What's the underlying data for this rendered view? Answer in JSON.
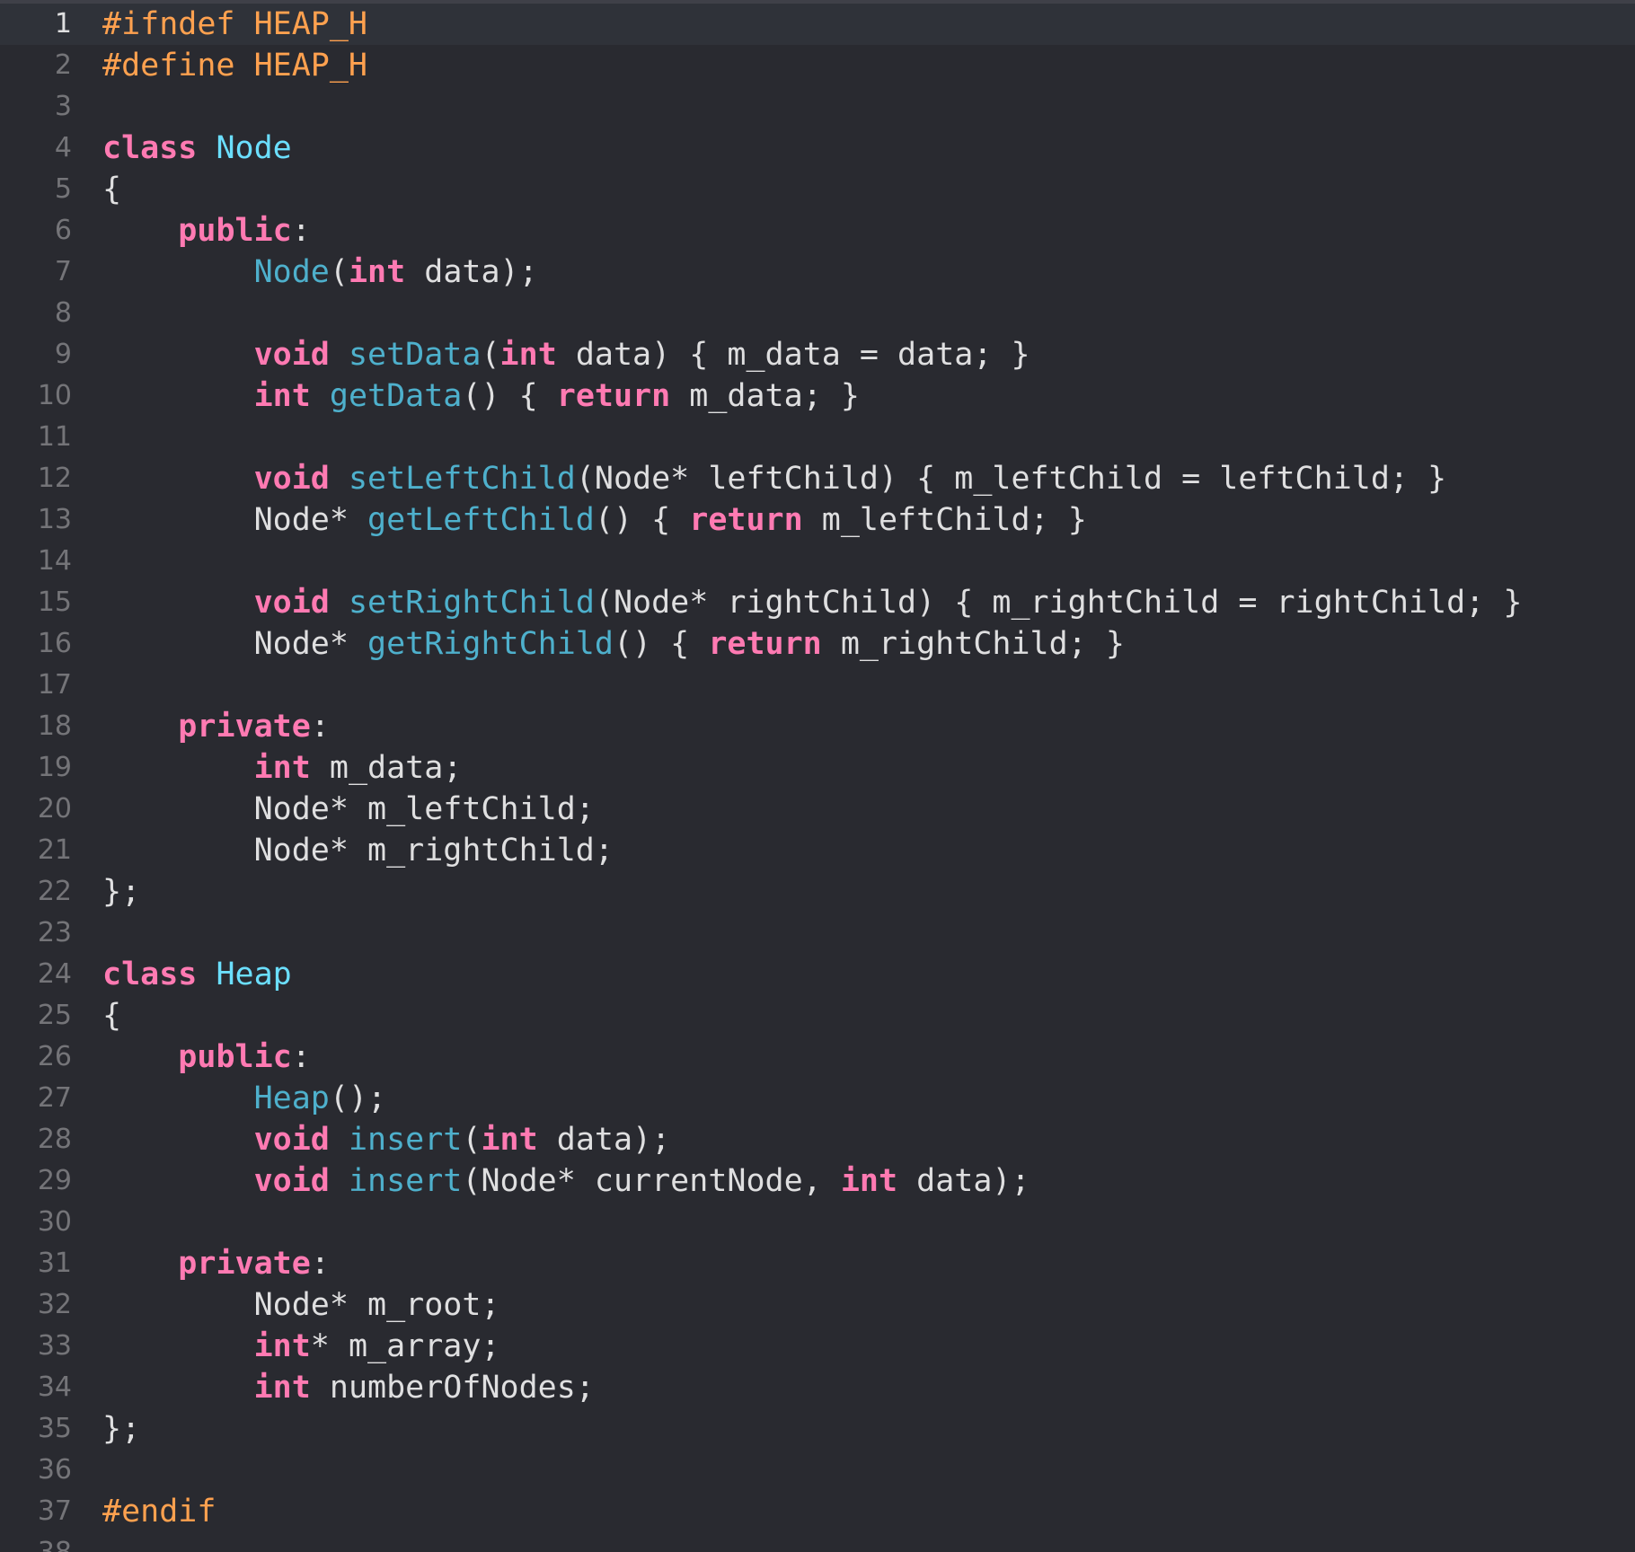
{
  "editor": {
    "language": "C++",
    "current_line": 1,
    "colors": {
      "background": "#292a30",
      "current_line_background": "#2f3239",
      "line_number": "#747478",
      "current_line_number": "#dfdfe0",
      "plain_text": "#dfdfe0",
      "keyword": "#ff7ab2",
      "preprocessor": "#ffa14f",
      "type_declaration": "#6bdfff",
      "function_name": "#4eb0cc"
    },
    "lines": [
      {
        "n": "1",
        "tokens": [
          {
            "t": "pp",
            "v": "#ifndef HEAP_H"
          }
        ]
      },
      {
        "n": "2",
        "tokens": [
          {
            "t": "pp",
            "v": "#define HEAP_H"
          }
        ]
      },
      {
        "n": "3",
        "tokens": []
      },
      {
        "n": "4",
        "tokens": [
          {
            "t": "kw",
            "v": "class"
          },
          {
            "t": "plain",
            "v": " "
          },
          {
            "t": "type",
            "v": "Node"
          }
        ]
      },
      {
        "n": "5",
        "tokens": [
          {
            "t": "plain",
            "v": "{"
          }
        ]
      },
      {
        "n": "6",
        "tokens": [
          {
            "t": "plain",
            "v": "    "
          },
          {
            "t": "kw",
            "v": "public"
          },
          {
            "t": "plain",
            "v": ":"
          }
        ]
      },
      {
        "n": "7",
        "tokens": [
          {
            "t": "plain",
            "v": "        "
          },
          {
            "t": "fn",
            "v": "Node"
          },
          {
            "t": "plain",
            "v": "("
          },
          {
            "t": "kw",
            "v": "int"
          },
          {
            "t": "plain",
            "v": " data);"
          }
        ]
      },
      {
        "n": "8",
        "tokens": []
      },
      {
        "n": "9",
        "tokens": [
          {
            "t": "plain",
            "v": "        "
          },
          {
            "t": "kw",
            "v": "void"
          },
          {
            "t": "plain",
            "v": " "
          },
          {
            "t": "fn",
            "v": "setData"
          },
          {
            "t": "plain",
            "v": "("
          },
          {
            "t": "kw",
            "v": "int"
          },
          {
            "t": "plain",
            "v": " data) { m_data = data; }"
          }
        ]
      },
      {
        "n": "10",
        "tokens": [
          {
            "t": "plain",
            "v": "        "
          },
          {
            "t": "kw",
            "v": "int"
          },
          {
            "t": "plain",
            "v": " "
          },
          {
            "t": "fn",
            "v": "getData"
          },
          {
            "t": "plain",
            "v": "() { "
          },
          {
            "t": "kw",
            "v": "return"
          },
          {
            "t": "plain",
            "v": " m_data; }"
          }
        ]
      },
      {
        "n": "11",
        "tokens": []
      },
      {
        "n": "12",
        "tokens": [
          {
            "t": "plain",
            "v": "        "
          },
          {
            "t": "kw",
            "v": "void"
          },
          {
            "t": "plain",
            "v": " "
          },
          {
            "t": "fn",
            "v": "setLeftChild"
          },
          {
            "t": "plain",
            "v": "(Node* leftChild) { m_leftChild = leftChild; }"
          }
        ]
      },
      {
        "n": "13",
        "tokens": [
          {
            "t": "plain",
            "v": "        Node* "
          },
          {
            "t": "fn",
            "v": "getLeftChild"
          },
          {
            "t": "plain",
            "v": "() { "
          },
          {
            "t": "kw",
            "v": "return"
          },
          {
            "t": "plain",
            "v": " m_leftChild; }"
          }
        ]
      },
      {
        "n": "14",
        "tokens": []
      },
      {
        "n": "15",
        "tokens": [
          {
            "t": "plain",
            "v": "        "
          },
          {
            "t": "kw",
            "v": "void"
          },
          {
            "t": "plain",
            "v": " "
          },
          {
            "t": "fn",
            "v": "setRightChild"
          },
          {
            "t": "plain",
            "v": "(Node* rightChild) { m_rightChild = rightChild; }"
          }
        ]
      },
      {
        "n": "16",
        "tokens": [
          {
            "t": "plain",
            "v": "        Node* "
          },
          {
            "t": "fn",
            "v": "getRightChild"
          },
          {
            "t": "plain",
            "v": "() { "
          },
          {
            "t": "kw",
            "v": "return"
          },
          {
            "t": "plain",
            "v": " m_rightChild; }"
          }
        ]
      },
      {
        "n": "17",
        "tokens": []
      },
      {
        "n": "18",
        "tokens": [
          {
            "t": "plain",
            "v": "    "
          },
          {
            "t": "kw",
            "v": "private"
          },
          {
            "t": "plain",
            "v": ":"
          }
        ]
      },
      {
        "n": "19",
        "tokens": [
          {
            "t": "plain",
            "v": "        "
          },
          {
            "t": "kw",
            "v": "int"
          },
          {
            "t": "plain",
            "v": " m_data;"
          }
        ]
      },
      {
        "n": "20",
        "tokens": [
          {
            "t": "plain",
            "v": "        Node* m_leftChild;"
          }
        ]
      },
      {
        "n": "21",
        "tokens": [
          {
            "t": "plain",
            "v": "        Node* m_rightChild;"
          }
        ]
      },
      {
        "n": "22",
        "tokens": [
          {
            "t": "plain",
            "v": "};"
          }
        ]
      },
      {
        "n": "23",
        "tokens": []
      },
      {
        "n": "24",
        "tokens": [
          {
            "t": "kw",
            "v": "class"
          },
          {
            "t": "plain",
            "v": " "
          },
          {
            "t": "type",
            "v": "Heap"
          }
        ]
      },
      {
        "n": "25",
        "tokens": [
          {
            "t": "plain",
            "v": "{"
          }
        ]
      },
      {
        "n": "26",
        "tokens": [
          {
            "t": "plain",
            "v": "    "
          },
          {
            "t": "kw",
            "v": "public"
          },
          {
            "t": "plain",
            "v": ":"
          }
        ]
      },
      {
        "n": "27",
        "tokens": [
          {
            "t": "plain",
            "v": "        "
          },
          {
            "t": "fn",
            "v": "Heap"
          },
          {
            "t": "plain",
            "v": "();"
          }
        ]
      },
      {
        "n": "28",
        "tokens": [
          {
            "t": "plain",
            "v": "        "
          },
          {
            "t": "kw",
            "v": "void"
          },
          {
            "t": "plain",
            "v": " "
          },
          {
            "t": "fn",
            "v": "insert"
          },
          {
            "t": "plain",
            "v": "("
          },
          {
            "t": "kw",
            "v": "int"
          },
          {
            "t": "plain",
            "v": " data);"
          }
        ]
      },
      {
        "n": "29",
        "tokens": [
          {
            "t": "plain",
            "v": "        "
          },
          {
            "t": "kw",
            "v": "void"
          },
          {
            "t": "plain",
            "v": " "
          },
          {
            "t": "fn",
            "v": "insert"
          },
          {
            "t": "plain",
            "v": "(Node* currentNode, "
          },
          {
            "t": "kw",
            "v": "int"
          },
          {
            "t": "plain",
            "v": " data);"
          }
        ]
      },
      {
        "n": "30",
        "tokens": []
      },
      {
        "n": "31",
        "tokens": [
          {
            "t": "plain",
            "v": "    "
          },
          {
            "t": "kw",
            "v": "private"
          },
          {
            "t": "plain",
            "v": ":"
          }
        ]
      },
      {
        "n": "32",
        "tokens": [
          {
            "t": "plain",
            "v": "        Node* m_root;"
          }
        ]
      },
      {
        "n": "33",
        "tokens": [
          {
            "t": "plain",
            "v": "        "
          },
          {
            "t": "kw",
            "v": "int"
          },
          {
            "t": "plain",
            "v": "* m_array;"
          }
        ]
      },
      {
        "n": "34",
        "tokens": [
          {
            "t": "plain",
            "v": "        "
          },
          {
            "t": "kw",
            "v": "int"
          },
          {
            "t": "plain",
            "v": " numberOfNodes;"
          }
        ]
      },
      {
        "n": "35",
        "tokens": [
          {
            "t": "plain",
            "v": "};"
          }
        ]
      },
      {
        "n": "36",
        "tokens": []
      },
      {
        "n": "37",
        "tokens": [
          {
            "t": "pp",
            "v": "#endif"
          }
        ]
      },
      {
        "n": "38",
        "tokens": []
      }
    ]
  }
}
